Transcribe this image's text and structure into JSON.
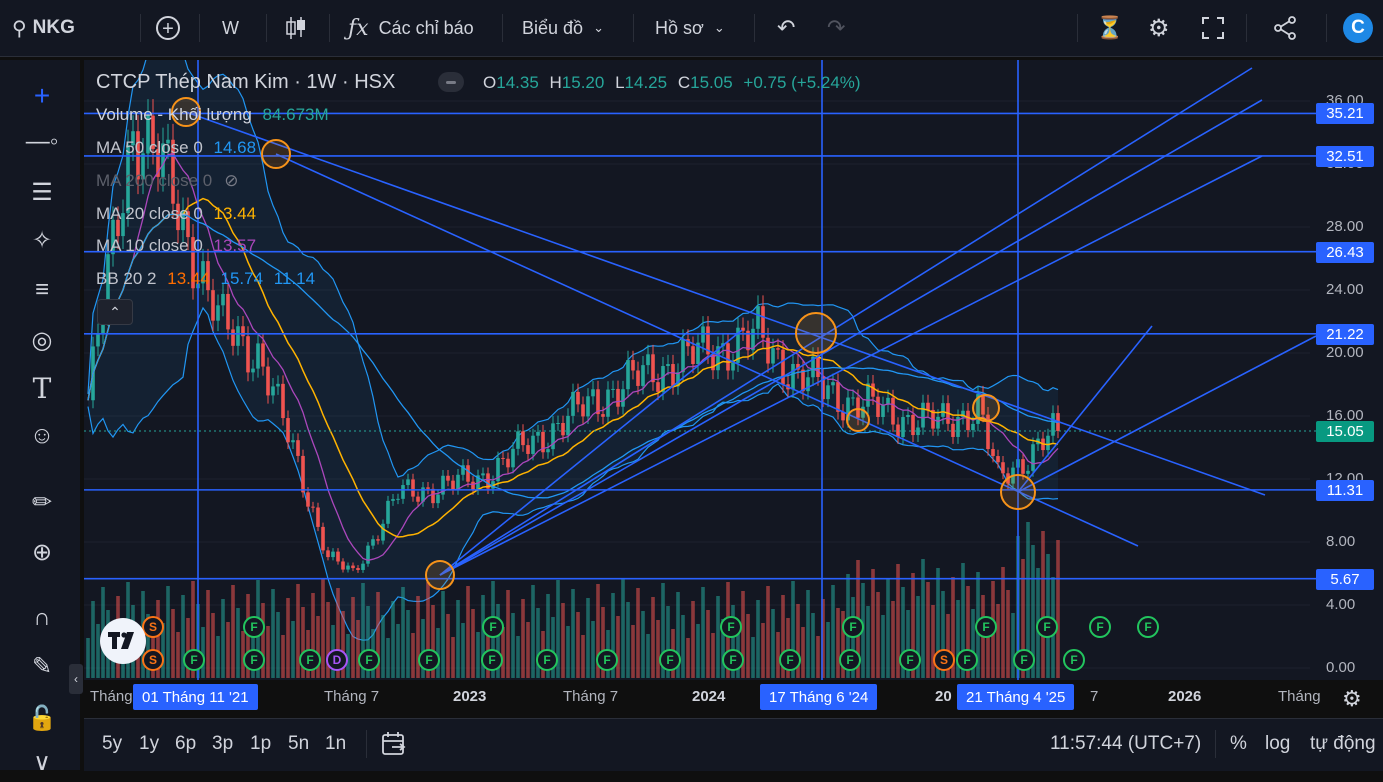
{
  "topbar": {
    "symbol": "NKG",
    "interval": "W",
    "indicators_label": "Các chỉ báo",
    "chart_label": "Biểu đồ",
    "profile_label": "Hồ sơ",
    "logo_letter": "C"
  },
  "legend": {
    "title": "CTCP Thép Nam Kim · 1W · HSX",
    "open_label": "O",
    "open": "14.35",
    "high_label": "H",
    "high": "15.20",
    "low_label": "L",
    "low": "14.25",
    "close_label": "C",
    "close": "15.05",
    "change": "+0.75 (+5.24%)",
    "volume_label": "Volume - Khối lượng",
    "volume_value": "84.673M",
    "ma50_label": "MA 50 close 0",
    "ma50_value": "14.68",
    "ma200_label": "MA 200 close 0",
    "ma20_label": "MA 20 close 0",
    "ma20_value": "13.44",
    "ma10_label": "MA 10 close 0",
    "ma10_value": "13.57",
    "bb_label": "BB 20 2",
    "bb_basis": "13.44",
    "bb_upper": "15.74",
    "bb_lower": "11.14"
  },
  "price_axis": {
    "ticks": [
      "36.00",
      "32.00",
      "28.00",
      "24.00",
      "20.00",
      "16.00",
      "12.00",
      "8.00",
      "4.00",
      "0.00"
    ],
    "level_boxes": [
      "35.21",
      "32.51",
      "26.43",
      "21.22",
      "15.05",
      "11.31",
      "5.67"
    ]
  },
  "time_axis": {
    "labels": [
      "Tháng",
      "Tháng 7",
      "2023",
      "Tháng 7",
      "2024",
      "20",
      "7",
      "2026",
      "Tháng"
    ],
    "crosshair_dates": [
      "01 Tháng 11 '21",
      "17 Tháng 6 '24",
      "21 Tháng 4 '25"
    ]
  },
  "events": {
    "row_top": [
      "S",
      "F",
      "F",
      "F",
      "F",
      "F",
      "F",
      "F",
      "F"
    ],
    "row_bottom": [
      "S",
      "F",
      "F",
      "F",
      "D",
      "F",
      "F",
      "F",
      "F",
      "F",
      "F",
      "F",
      "F",
      "F",
      "F",
      "S",
      "F",
      "F",
      "F"
    ]
  },
  "bottombar": {
    "ranges": [
      "5y",
      "1y",
      "6p",
      "3p",
      "1p",
      "5n",
      "1n"
    ],
    "time": "11:57:44 (UTC+7)",
    "percent": "%",
    "log": "log",
    "auto": "tự động"
  },
  "colors": {
    "background": "#131722",
    "accent": "#2962ff",
    "up": "#26a69a",
    "down": "#ef5350",
    "ma50": "#2196f3",
    "ma20": "#ffb300",
    "ma10": "#ab47bc",
    "bb": "#2196f3",
    "circle": "#f7931a"
  },
  "chart_data": {
    "type": "candlestick",
    "interval": "1W",
    "ylim": [
      0,
      37
    ],
    "x": [
      "2021-09",
      "2021-11",
      "2022-01",
      "2022-04",
      "2022-07",
      "2022-10",
      "2022-11",
      "2023-01",
      "2023-04",
      "2023-07",
      "2023-10",
      "2024-01",
      "2024-04",
      "2024-06",
      "2024-08",
      "2024-10",
      "2025-01",
      "2025-03",
      "2025-04",
      "2025-06",
      "2025-07"
    ],
    "close": [
      17.0,
      34.5,
      27.0,
      30.5,
      22.0,
      13.0,
      6.0,
      11.0,
      12.0,
      15.0,
      17.5,
      19.5,
      20.5,
      21.0,
      18.5,
      17.0,
      16.0,
      15.5,
      12.0,
      13.5,
      15.05
    ],
    "volume": [
      30,
      45,
      40,
      35,
      30,
      55,
      60,
      40,
      35,
      40,
      45,
      50,
      55,
      48,
      40,
      38,
      42,
      70,
      50,
      60,
      84.673
    ],
    "horizontal_levels": [
      35.21,
      32.51,
      26.43,
      21.22,
      11.31,
      5.67
    ],
    "last_price": 15.05
  }
}
